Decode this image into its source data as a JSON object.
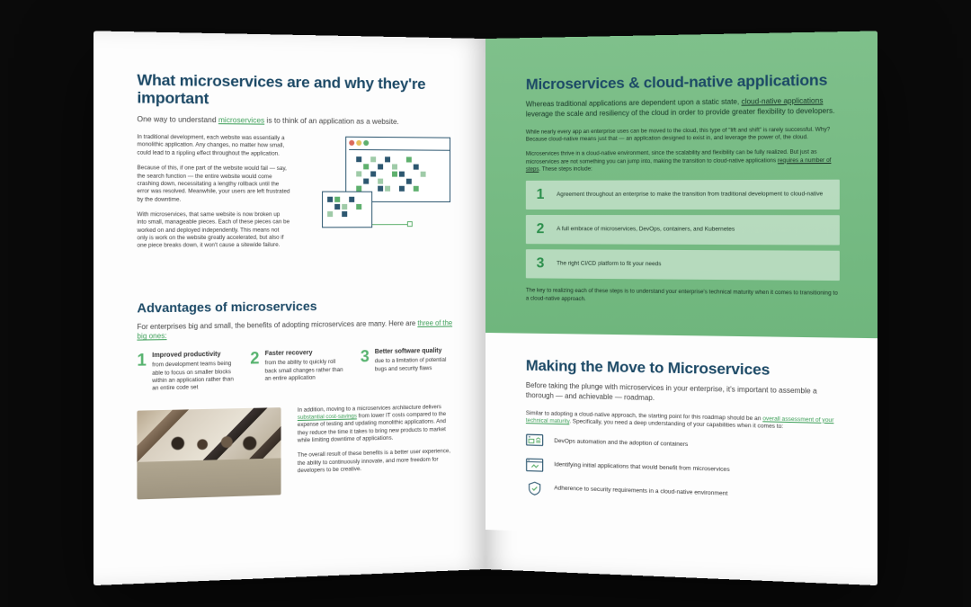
{
  "left": {
    "h1": "What microservices are and why they're important",
    "lead_a": "One way to understand ",
    "lead_link": "microservices",
    "lead_b": " is to think of an application as a website.",
    "p1": "In traditional development, each website was essentially a monolithic application. Any changes, no matter how small, could lead to a rippling effect throughout the application.",
    "p2": "Because of this, if one part of the website would fail — say, the search function — the entire website would come crashing down, necessitating a lengthy rollback until the error was resolved. Meanwhile, your users are left frustrated by the downtime.",
    "p3": "With microservices, that same website is now broken up into small, manageable pieces. Each of these pieces can be worked on and deployed independently. This means not only is work on the website greatly accelerated, but also if one piece breaks down, it won't cause a sitewide failure.",
    "h2": "Advantages of microservices",
    "adv_lead_a": "For enterprises big and small, the benefits of adopting microservices are many. Here are ",
    "adv_lead_link": "three of the big ones:",
    "items": [
      {
        "n": "1",
        "title": "Improved productivity",
        "body": "from development teams being able to focus on smaller blocks within an application rather than an entire code set"
      },
      {
        "n": "2",
        "title": "Faster recovery",
        "body": "from the ability to quickly roll back small changes rather than an entire application"
      },
      {
        "n": "3",
        "title": "Better software quality",
        "body": "due to a limitation of potential bugs and security flaws"
      }
    ],
    "bp1_a": "In addition, moving to a microservices architecture delivers ",
    "bp1_link": "substantial cost-savings",
    "bp1_b": " from lower IT costs compared to the expense of testing and updating monolithic applications. And they reduce the time it takes to bring new products to market while limiting downtime of applications.",
    "bp2": "The overall result of these benefits is a better user experience, the ability to continuously innovate, and more freedom for developers to be creative."
  },
  "right": {
    "green": {
      "h1": "Microservices & cloud-native applications",
      "lead_a": "Whereas traditional applications are dependent upon a static state, ",
      "lead_link": "cloud-native applications",
      "lead_b": " leverage the scale and resiliency of the cloud in order to provide greater flexibility to developers.",
      "p1": "While nearly every app an enterprise uses can be moved to the cloud, this type of \"lift and shift\" is rarely successful. Why? Because cloud-native means just that — an application designed to exist in, and leverage the power of, the cloud.",
      "p2_a": "Microservices thrive in a cloud-native environment, since the scalability and flexibility can be fully realized. But just as microservices are not something you can jump into, making the transition to cloud-native applications ",
      "p2_link": "requires a number of steps",
      "p2_b": ". These steps include:",
      "steps": [
        {
          "n": "1",
          "t": "Agreement throughout an enterprise to make the transition from traditional development to cloud-native"
        },
        {
          "n": "2",
          "t": "A full embrace of microservices, DevOps, containers, and Kubernetes"
        },
        {
          "n": "3",
          "t": "The right CI/CD platform to fit your needs"
        }
      ],
      "closing": "The key to realizing each of these steps is to understand your enterprise's technical maturity when it comes to transitioning to a cloud-native approach."
    },
    "lower": {
      "h1": "Making the Move to Microservices",
      "lead": "Before taking the plunge with microservices in your enterprise, it's important to assemble a thorough — and achievable — roadmap.",
      "p_a": "Similar to adopting a cloud-native approach, the starting point for this roadmap should be an ",
      "p_link": "overall assessment of your technical maturity",
      "p_b": ". Specifically, you need a deep understanding of your capabilities when it comes to:",
      "icons": [
        {
          "t": "DevOps automation and the adoption of containers"
        },
        {
          "t": "Identifying initial applications that would benefit from microservices"
        },
        {
          "t": "Adherence to security requirements in a cloud-native environment"
        }
      ]
    }
  }
}
